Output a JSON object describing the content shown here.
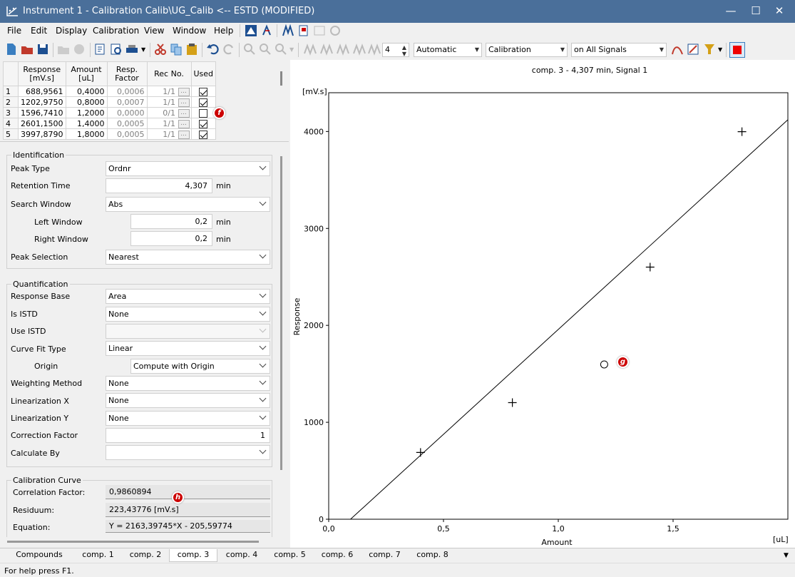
{
  "window": {
    "title": "Instrument 1 - Calibration Calib\\UG_Calib <-- ESTD (MODIFIED)",
    "minimize": "—",
    "maximize": "☐",
    "close": "✕"
  },
  "menu": {
    "file": "File",
    "edit": "Edit",
    "display": "Display",
    "calibration": "Calibration",
    "view": "View",
    "window": "Window",
    "help": "Help"
  },
  "toolbar": {
    "spin_value": "4",
    "mode": "Automatic",
    "type": "Calibration",
    "signals": "on All Signals"
  },
  "table": {
    "headers": [
      "Response\n[mV.s]",
      "Amount\n[uL]",
      "Resp.\nFactor",
      "Rec No.",
      "Used"
    ],
    "rows": [
      {
        "n": "1",
        "response": "688,9561",
        "amount": "0,4000",
        "factor": "0,0006",
        "rec": "1/1",
        "used": true
      },
      {
        "n": "2",
        "response": "1202,9750",
        "amount": "0,8000",
        "factor": "0,0007",
        "rec": "1/1",
        "used": true
      },
      {
        "n": "3",
        "response": "1596,7410",
        "amount": "1,2000",
        "factor": "0,0000",
        "rec": "0/1",
        "used": false
      },
      {
        "n": "4",
        "response": "2601,1500",
        "amount": "1,4000",
        "factor": "0,0005",
        "rec": "1/1",
        "used": true
      },
      {
        "n": "5",
        "response": "3997,8790",
        "amount": "1,8000",
        "factor": "0,0005",
        "rec": "1/1",
        "used": true
      }
    ],
    "dots": "..."
  },
  "identification": {
    "title": "Identification",
    "peak_type_label": "Peak Type",
    "peak_type": "Ordnr",
    "rt_label": "Retention Time",
    "rt": "4,307",
    "rt_unit": "min",
    "search_label": "Search Window",
    "search": "Abs",
    "left_label": "Left Window",
    "left": "0,2",
    "left_unit": "min",
    "right_label": "Right Window",
    "right": "0,2",
    "right_unit": "min",
    "peaksel_label": "Peak Selection",
    "peaksel": "Nearest"
  },
  "quantification": {
    "title": "Quantification",
    "respbase_label": "Response Base",
    "respbase": "Area",
    "istd_label": "Is ISTD",
    "istd": "None",
    "useistd_label": "Use ISTD",
    "useistd": "",
    "fit_label": "Curve Fit Type",
    "fit": "Linear",
    "origin_label": "Origin",
    "origin": "Compute with Origin",
    "weight_label": "Weighting Method",
    "weight": "None",
    "linx_label": "Linearization X",
    "linx": "None",
    "liny_label": "Linearization Y",
    "liny": "None",
    "corr_label": "Correction Factor",
    "corr": "1",
    "calcby_label": "Calculate By",
    "calcby": ""
  },
  "curve": {
    "title": "Calibration Curve",
    "corr_label": "Correlation Factor:",
    "corr": "0,9860894",
    "resid_label": "Residuum:",
    "resid": "223,43776 [mV.s]",
    "eq_label": "Equation:",
    "eq": "Y = 2163,39745*X - 205,59774"
  },
  "badges": {
    "f": "f",
    "g": "g",
    "h": "h"
  },
  "chart_data": {
    "type": "scatter",
    "title": "comp. 3 - 4,307 min, Signal 1",
    "xlabel": "Amount",
    "ylabel": "Response",
    "xunit": "[uL]",
    "yunit": "[mV.s]",
    "xlim": [
      0,
      2.0
    ],
    "ylim": [
      0,
      4400
    ],
    "xticks": [
      0,
      0.5,
      1.0,
      1.5
    ],
    "xticklabels": [
      "0,0",
      "0,5",
      "1,0",
      "1,5"
    ],
    "yticks": [
      0,
      1000,
      2000,
      3000,
      4000
    ],
    "yticklabels": [
      "0",
      "1000",
      "2000",
      "3000",
      "4000"
    ],
    "points": [
      {
        "x": 0.4,
        "y": 688.9561,
        "marker": "plus"
      },
      {
        "x": 0.8,
        "y": 1202.975,
        "marker": "plus"
      },
      {
        "x": 1.2,
        "y": 1596.741,
        "marker": "circle"
      },
      {
        "x": 1.4,
        "y": 2601.15,
        "marker": "plus"
      },
      {
        "x": 1.8,
        "y": 3997.879,
        "marker": "plus"
      }
    ],
    "fit": {
      "slope": 2163.39745,
      "intercept": -205.59774
    }
  },
  "tabs": [
    "Compounds",
    "comp. 1",
    "comp. 2",
    "comp. 3",
    "comp. 4",
    "comp. 5",
    "comp. 6",
    "comp. 7",
    "comp. 8"
  ],
  "active_tab": "comp. 3",
  "status": "For help press F1."
}
